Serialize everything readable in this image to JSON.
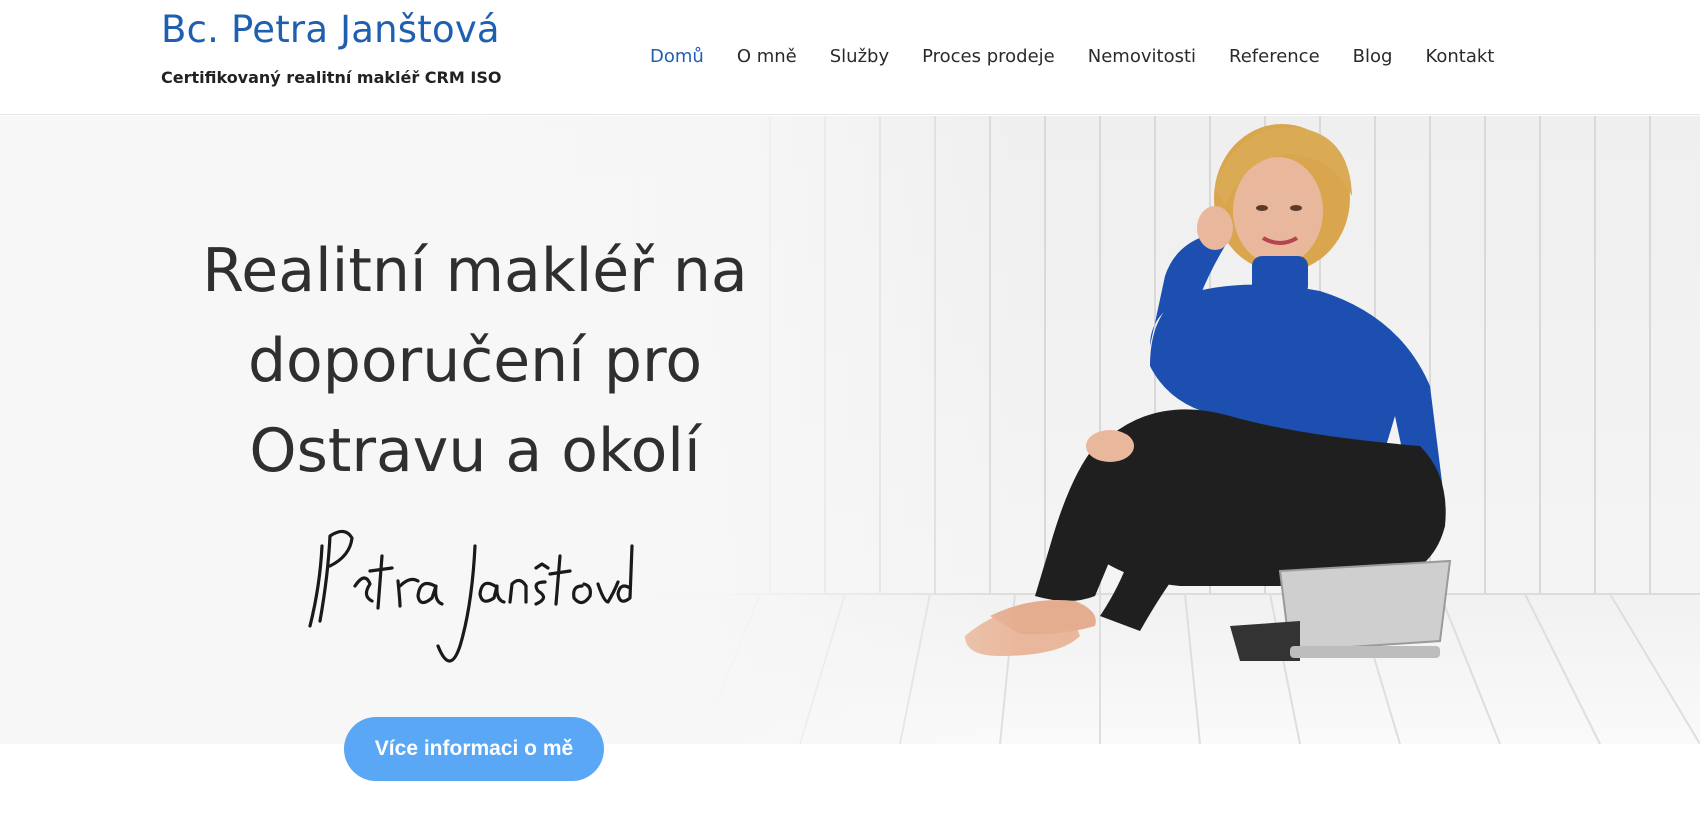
{
  "header": {
    "site_title": "Bc. Petra Janštová",
    "tagline": "Certifikovaný realitní makléř CRM ISO"
  },
  "nav": {
    "items": [
      {
        "label": "Domů",
        "active": true
      },
      {
        "label": "O mně",
        "active": false
      },
      {
        "label": "Služby",
        "active": false
      },
      {
        "label": "Proces prodeje",
        "active": false
      },
      {
        "label": "Nemovitosti",
        "active": false
      },
      {
        "label": "Reference",
        "active": false
      },
      {
        "label": "Blog",
        "active": false
      },
      {
        "label": "Kontakt",
        "active": false
      }
    ]
  },
  "hero": {
    "headline_lines": [
      "Realitní makléř na",
      "doporučení pro",
      "Ostravu a okolí"
    ],
    "signature": "Petra Janštová",
    "cta_label": "Více informaci o mě"
  },
  "colors": {
    "brand_blue": "#1f5fb0",
    "cta_blue": "#59a7f5",
    "sweater_blue": "#1d4fb0"
  }
}
